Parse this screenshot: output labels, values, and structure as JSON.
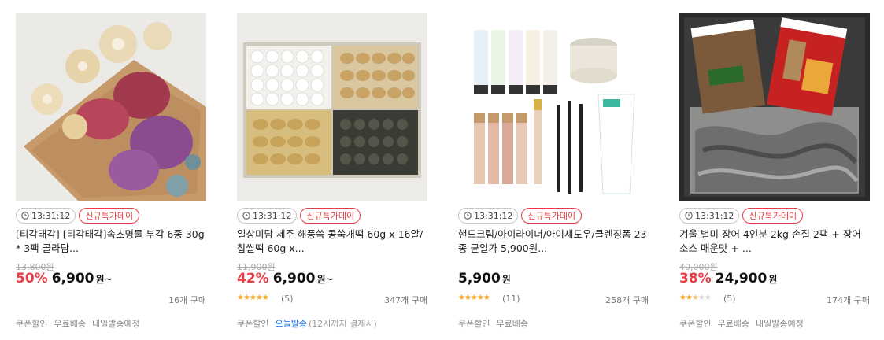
{
  "products": [
    {
      "image": "lotus-chips-photo",
      "timer": "13:31:12",
      "badge": "신규특가데이",
      "title": "[티각태각] [티각태각]속초명물 부각 6종 30g * 3팩 골라담...",
      "original_price": "13,800원",
      "discount_rate": "50%",
      "price": "6,900",
      "price_unit": "원~",
      "rating": null,
      "review_count": "",
      "purchase_count": "16개 구매",
      "tags": [
        "쿠폰할인",
        "무료배송",
        "내일발송예정"
      ],
      "tag_note": ""
    },
    {
      "image": "rice-cake-box-photo",
      "timer": "13:31:12",
      "badge": "신규특가데이",
      "title": "일상미담 제주 해풍쑥 콩쑥개떡 60g x 16알/찹쌀떡 60g x...",
      "original_price": "11,900원",
      "discount_rate": "42%",
      "price": "6,900",
      "price_unit": "원~",
      "rating": 5,
      "review_count": "(5)",
      "purchase_count": "347개 구매",
      "tags": [
        "쿠폰할인",
        "오늘발송"
      ],
      "tag_note": "(12시까지 결제시)"
    },
    {
      "image": "cosmetics-set-photo",
      "timer": "13:31:12",
      "badge": "신규특가데이",
      "title": "핸드크림/아이라이너/아이섀도우/클렌징폼 23종 균일가 5,900원...",
      "original_price": "",
      "discount_rate": "",
      "price": "5,900",
      "price_unit": "원",
      "rating": 4.5,
      "review_count": "(11)",
      "purchase_count": "258개 구매",
      "tags": [
        "쿠폰할인",
        "무료배송"
      ],
      "tag_note": ""
    },
    {
      "image": "eel-package-photo",
      "timer": "13:31:12",
      "badge": "신규특가데이",
      "title": "겨울 별미 장어 4인분 2kg 손질 2팩 + 장어소스 매운맛 + ...",
      "original_price": "40,000원",
      "discount_rate": "38%",
      "price": "24,900",
      "price_unit": "원",
      "rating": 2.5,
      "review_count": "(5)",
      "purchase_count": "174개 구매",
      "tags": [
        "쿠폰할인",
        "무료배송",
        "내일발송예정"
      ],
      "tag_note": ""
    }
  ],
  "colors": {
    "discount": "#e73c43",
    "badge": "#e73c43",
    "star": "#f5a623",
    "today_ship": "#1a73e8"
  }
}
